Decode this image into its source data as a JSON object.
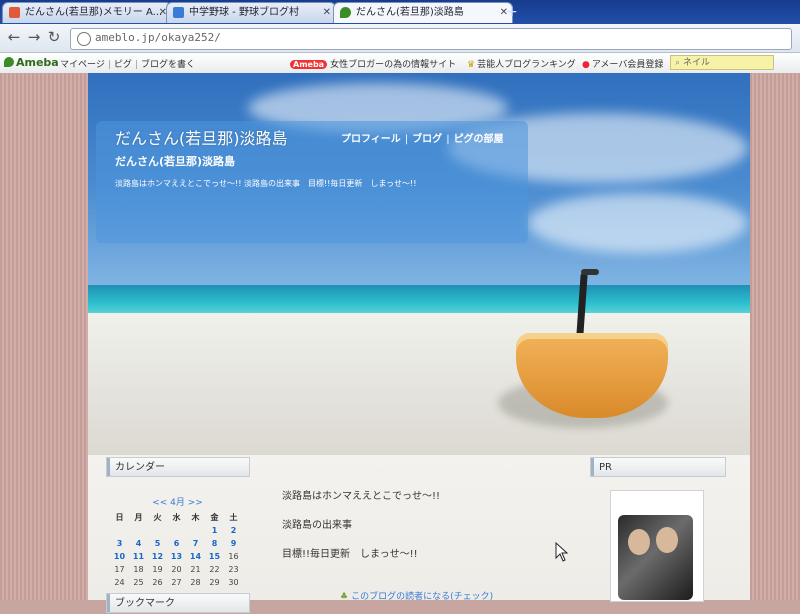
{
  "browser": {
    "tabs": [
      {
        "title": "だんさん(若旦那)メモリー A...",
        "active": false,
        "color": "#e05a3a"
      },
      {
        "title": "中学野球 - 野球ブログ村",
        "active": false,
        "color": "#3a7bd5"
      },
      {
        "title": "だんさん(若旦那)淡路島",
        "active": true,
        "color": "#3b8c24"
      }
    ],
    "new_tab_glyph": "+",
    "url": "ameblo.jp/okaya252/"
  },
  "ameba_bar": {
    "logo": "Ameba",
    "nav": [
      "マイページ",
      "ピグ",
      "ブログを書く"
    ],
    "promo_badge": "Ameba",
    "promo_text": "女性ブロガーの為の情報サイト",
    "ranking": "芸能人ブログランキング",
    "member": "アメーバ会員登録",
    "search_placeholder": "ネイル"
  },
  "blog": {
    "title": "だんさん(若旦那)淡路島",
    "header_nav": [
      "プロフィール",
      "ブログ",
      "ピグの部屋"
    ],
    "subtitle": "だんさん(若旦那)淡路島",
    "description": "淡路島はホンマええとこでっせ〜!! 淡路島の出来事　目標!!毎日更新　しまっせ〜!!"
  },
  "sidebar": {
    "calendar_header": "カレンダー",
    "calendar": {
      "month_label": "<< 4月 >>",
      "weekdays": [
        "日",
        "月",
        "火",
        "水",
        "木",
        "金",
        "土"
      ],
      "days": [
        "",
        "",
        "",
        "",
        "",
        "1",
        "2",
        "3",
        "4",
        "5",
        "6",
        "7",
        "8",
        "9",
        "10",
        "11",
        "12",
        "13",
        "14",
        "15",
        "16",
        "17",
        "18",
        "19",
        "20",
        "21",
        "22",
        "23",
        "24",
        "25",
        "26",
        "27",
        "28",
        "29",
        "30"
      ],
      "linked_days": [
        "1",
        "2",
        "3",
        "4",
        "5",
        "6",
        "7",
        "8",
        "9",
        "10",
        "11",
        "12",
        "13",
        "14",
        "15"
      ]
    },
    "next_header": "ブックマーク"
  },
  "main": {
    "posts": [
      "淡路島はホンマええとこでっせ〜!!",
      "淡路島の出来事",
      "目標!!毎日更新　しまっせ〜!!"
    ],
    "reader_link": "このブログの読者になる(チェック)"
  },
  "right_sidebar": {
    "pr_header": "PR"
  },
  "colors": {
    "link": "#1b67c9",
    "accent_green": "#3b8c24"
  }
}
